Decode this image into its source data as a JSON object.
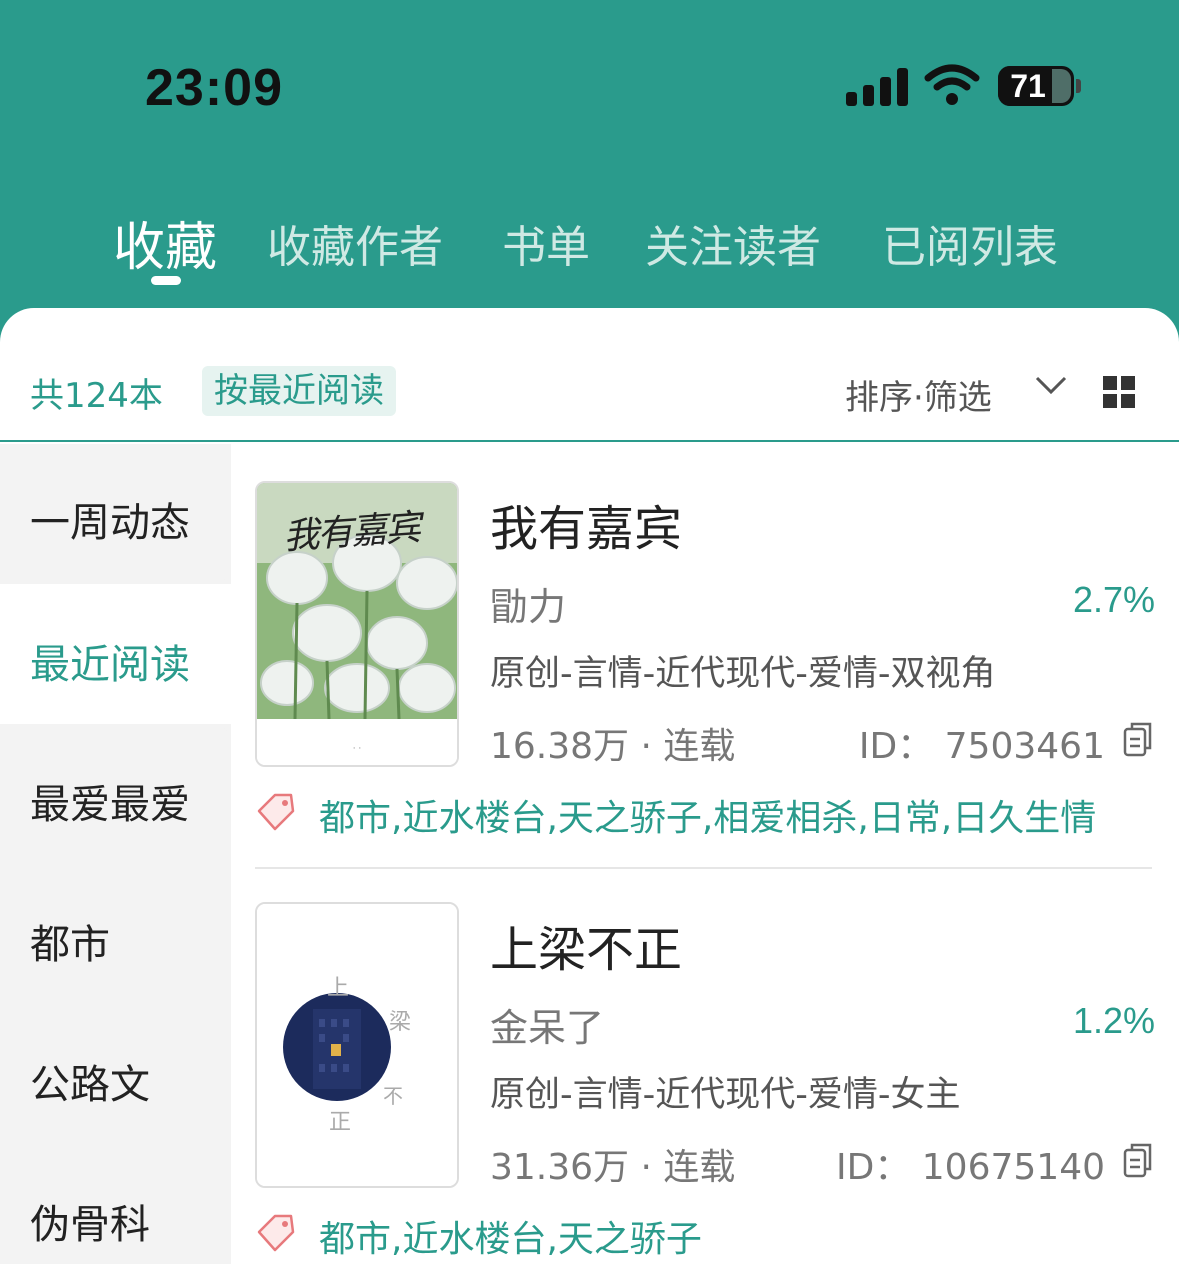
{
  "status_bar": {
    "time": "23:09",
    "battery": "71"
  },
  "tabs": [
    {
      "label": "收藏",
      "active": true
    },
    {
      "label": "收藏作者"
    },
    {
      "label": "书单"
    },
    {
      "label": "关注读者"
    },
    {
      "label": "已阅列表"
    }
  ],
  "toolbar": {
    "count": "共124本",
    "sort_chip": "按最近阅读",
    "filter_label": "排序·筛选"
  },
  "sidebar": {
    "items": [
      {
        "label": "一周动态"
      },
      {
        "label": "最近阅读",
        "active": true
      },
      {
        "label": "最爱最爱"
      },
      {
        "label": "都市"
      },
      {
        "label": "公路文"
      },
      {
        "label": "伪骨科"
      }
    ]
  },
  "books": [
    {
      "title": "我有嘉宾",
      "author": "勖力",
      "progress": "2.7%",
      "genre": "原创-言情-近代现代-爱情-双视角",
      "words": "16.38万 · 连载",
      "id": "ID：  7503461",
      "tags": "都市,近水楼台,天之骄子,相爱相杀,日常,日久生情",
      "cover_title": "我有嘉宾"
    },
    {
      "title": "上梁不正",
      "author": "金呆了",
      "progress": "1.2%",
      "genre": "原创-言情-近代现代-爱情-女主",
      "words": "31.36万 · 连载",
      "id": "ID：  10675140",
      "tags": "都市,近水楼台,天之骄子",
      "cover_chars": [
        "上",
        "梁",
        "不",
        "正"
      ]
    }
  ],
  "colors": {
    "accent": "#2a9b8c",
    "header_bg": "#2a9b8c",
    "sidebar_bg": "#f3f3f3"
  }
}
